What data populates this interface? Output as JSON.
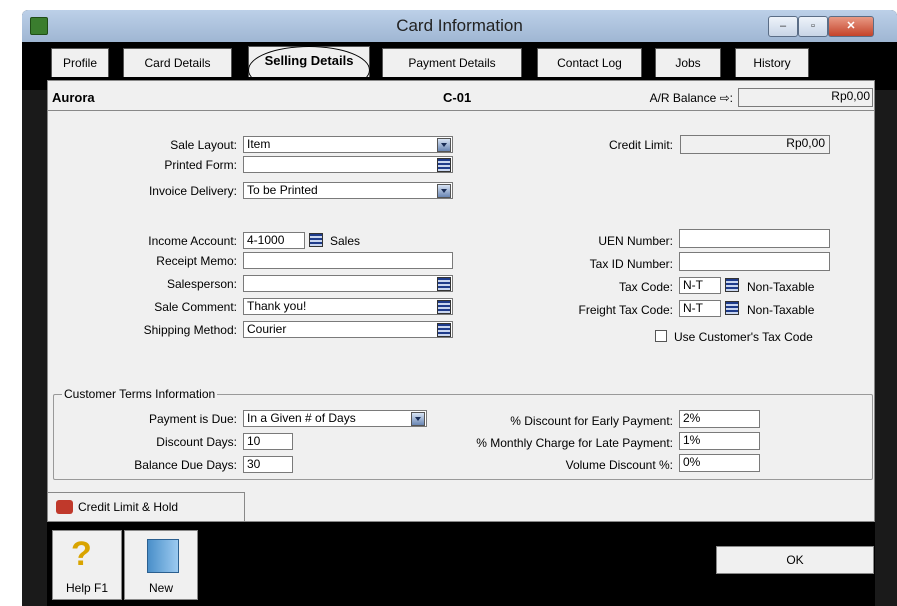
{
  "window": {
    "title": "Card Information"
  },
  "title_buttons": {
    "minimize": "–",
    "maximize": "▫",
    "close": "✕"
  },
  "tabs": [
    "Profile",
    "Card Details",
    "Selling Details",
    "Payment Details",
    "Contact Log",
    "Jobs",
    "History"
  ],
  "header": {
    "card_name": "Aurora",
    "card_id": "C-01",
    "ar_balance_label": "A/R Balance ⇨:",
    "ar_balance_value": "Rp0,00"
  },
  "selling": {
    "sale_layout_label": "Sale Layout:",
    "sale_layout_value": "Item",
    "printed_form_label": "Printed Form:",
    "printed_form_value": "",
    "invoice_delivery_label": "Invoice Delivery:",
    "invoice_delivery_value": "To be Printed",
    "income_account_label": "Income Account:",
    "income_account_value": "4-1000",
    "income_account_name": "Sales",
    "receipt_memo_label": "Receipt Memo:",
    "receipt_memo_value": "",
    "salesperson_label": "Salesperson:",
    "salesperson_value": "",
    "sale_comment_label": "Sale Comment:",
    "sale_comment_value": "Thank you!",
    "shipping_method_label": "Shipping Method:",
    "shipping_method_value": "Courier"
  },
  "credit": {
    "credit_limit_label": "Credit Limit:",
    "credit_limit_value": "Rp0,00"
  },
  "tax": {
    "uen_label": "UEN Number:",
    "uen_value": "",
    "tax_id_label": "Tax ID Number:",
    "tax_id_value": "",
    "tax_code_label": "Tax Code:",
    "tax_code_value": "N-T",
    "tax_code_desc": "Non-Taxable",
    "freight_tax_code_label": "Freight Tax Code:",
    "freight_tax_code_value": "N-T",
    "freight_tax_code_desc": "Non-Taxable",
    "use_customer_tax_code_label": "Use Customer's Tax Code",
    "use_customer_tax_code_checked": false
  },
  "terms": {
    "group_title": "Customer Terms Information",
    "payment_due_label": "Payment is Due:",
    "payment_due_value": "In a Given # of Days",
    "discount_days_label": "Discount Days:",
    "discount_days_value": "10",
    "balance_due_days_label": "Balance Due Days:",
    "balance_due_days_value": "30",
    "early_payment_label": "% Discount for Early Payment:",
    "early_payment_value": "2%",
    "late_payment_label": "% Monthly Charge for Late Payment:",
    "late_payment_value": "1%",
    "volume_discount_label": "Volume Discount %:",
    "volume_discount_value": "0%"
  },
  "credit_limit_hold_button": "Credit Limit & Hold",
  "footer": {
    "help_label": "Help F1",
    "new_label": "New",
    "ok_label": "OK"
  }
}
